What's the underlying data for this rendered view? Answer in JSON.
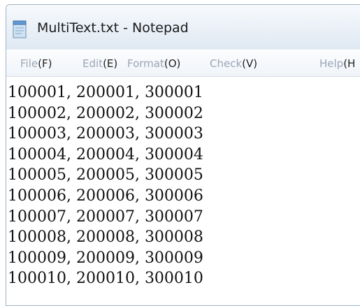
{
  "window": {
    "title": "MultiText.txt - Notepad",
    "icon": "notepad-icon"
  },
  "menu": [
    {
      "label": "File",
      "key": "(F)"
    },
    {
      "label": "Edit",
      "key": "(E)"
    },
    {
      "label": "Format",
      "key": "(O)"
    },
    {
      "label": "Check",
      "key": "(V)"
    },
    {
      "label": "Help",
      "key": "(H"
    }
  ],
  "content": {
    "lines": [
      "100001, 200001, 300001",
      "100002, 200002, 300002",
      "100003, 200003, 300003",
      "100004, 200004, 300004",
      "100005, 200005, 300005",
      "100006, 200006, 300006",
      "100007, 200007, 300007",
      "100008, 200008, 300008",
      "100009, 200009, 300009",
      "100010, 200010, 300010"
    ]
  }
}
